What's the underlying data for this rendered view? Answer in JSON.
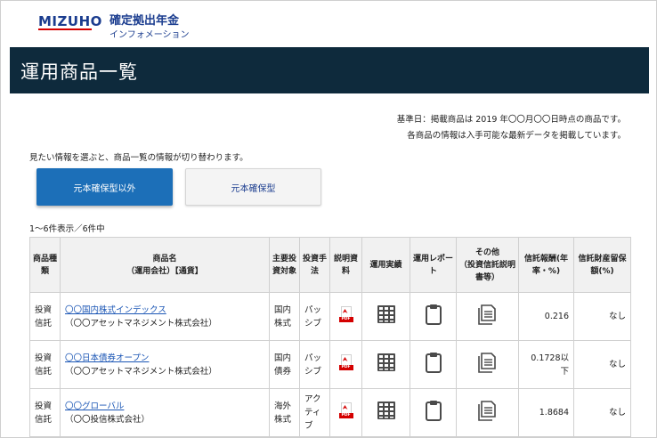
{
  "header": {
    "logo_text": "MIZUHO",
    "site_title": "確定拠出年金",
    "site_subtitle": "インフォメーション"
  },
  "banner": {
    "title": "運用商品一覧"
  },
  "notes": {
    "line1": "基準日：掲載商品は 2019 年〇〇月〇〇日時点の商品です。",
    "line2": "各商品の情報は入手可能な最新データを掲載しています。"
  },
  "hint": "見たい情報を選ぶと、商品一覧の情報が切り替わります。",
  "toggle": {
    "active_label": "元本確保型以外",
    "inactive_label": "元本確保型"
  },
  "count_text": "1～6件表示／6件中",
  "table": {
    "headers": {
      "kind": "商品種類",
      "name_line1": "商品名",
      "name_line2": "（運用会社）【通貨】",
      "target": "主要投資対象",
      "method": "投資手法",
      "docs": "説明資料",
      "performance": "運用実績",
      "report": "運用レポート",
      "other_line1": "その他",
      "other_line2": "（投資信託説明書等）",
      "fee": "信託報酬(年率・%)",
      "reserve": "信託財産留保額(%)"
    },
    "rows": [
      {
        "kind": "投資信託",
        "name": "〇〇国内株式インデックス",
        "company": "（〇〇アセットマネジメント株式会社）",
        "target": "国内株式",
        "method": "パッシブ",
        "fee": "0.216",
        "reserve": "なし"
      },
      {
        "kind": "投資信託",
        "name": "〇〇日本債券オープン",
        "company": "（〇〇アセットマネジメント株式会社）",
        "target": "国内債券",
        "method": "パッシブ",
        "fee": "0.1728以下",
        "reserve": "なし"
      },
      {
        "kind": "投資信託",
        "name": "〇〇グローバル",
        "company": "（〇〇投信株式会社）",
        "target": "海外株式",
        "method": "アクティブ",
        "fee": "1.8684",
        "reserve": "なし"
      }
    ]
  },
  "icons": {
    "pdf_label": "PDF",
    "pdf": "pdf-icon",
    "performance": "table-grid-icon",
    "report": "clipboard-icon",
    "other": "documents-icon"
  },
  "colors": {
    "brand": "#1b3d8f",
    "accent_red": "#d40000",
    "banner_bg": "#0e2a3c",
    "active_button": "#1c6fb8",
    "link": "#1b56b5"
  }
}
